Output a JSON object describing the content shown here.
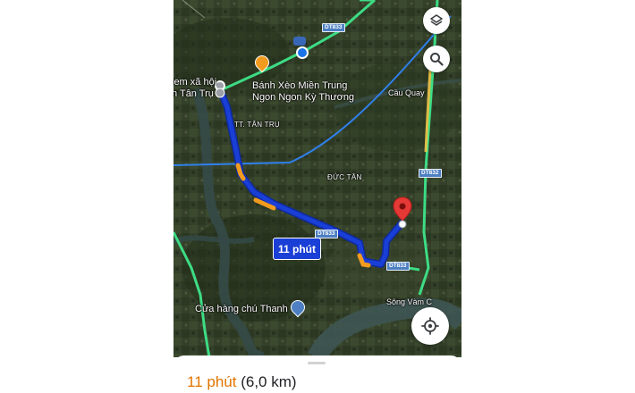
{
  "map": {
    "places": {
      "poi_left_line1": "iem xã hội",
      "poi_left_line2": "n Tân Trụ",
      "restaurant_line1": "Bánh Xèo Miền Trung",
      "restaurant_line2": "Ngon Ngon Kỳ Thương",
      "town_tan_tru": "TT. TÂN TRỤ",
      "bridge": "Cầu Quay",
      "commune_duc_tan": "ĐỨC TÂN",
      "store": "Cửa hàng chú Thanh",
      "river": "Sông Vàm C"
    },
    "road_shields": {
      "top": "DT833",
      "right": "DT832",
      "middle": "DT833",
      "bottom": "DT833"
    },
    "route_eta_label": "11 phút",
    "icons": {
      "layers": "layers-icon",
      "search": "search-icon",
      "recenter": "my-location-icon",
      "destination": "red-map-pin-icon",
      "origin": "blue-location-dot-icon",
      "restaurant": "restaurant-pin-icon",
      "store": "shopping-bag-pin-icon"
    },
    "colors": {
      "route": "#1a3fd6",
      "route_traffic": "#f29b1f",
      "major_road": "#3ddc84",
      "power_line": "#2f80ed",
      "destination_pin": "#e53935"
    }
  },
  "route_summary": {
    "time": "11 phút",
    "distance": "(6,0 km)"
  }
}
